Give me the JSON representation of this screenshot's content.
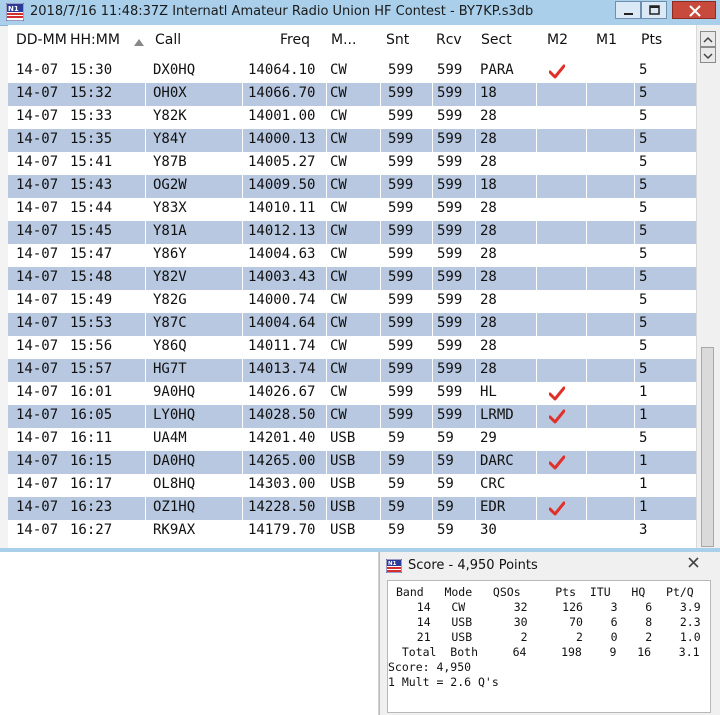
{
  "window": {
    "title": "2018/7/16 11:48:37Z  Internatl Amateur Radio Union HF Contest - BY7KP.s3db",
    "icon": "n1mm-logo-icon"
  },
  "columns": [
    "DD-MM",
    "HH:MM",
    "Call",
    "Freq",
    "M...",
    "Snt",
    "Rcv",
    "Sect",
    "M2",
    "M1",
    "Pts"
  ],
  "rows": [
    {
      "date": "14-07",
      "time": "15:30",
      "call": "DX0HQ",
      "freq": "14064.10",
      "mode": "CW",
      "snt": "599",
      "rcv": "599",
      "sect": "PARA",
      "m2": true,
      "m1": false,
      "pts": "5"
    },
    {
      "date": "14-07",
      "time": "15:32",
      "call": "OH0X",
      "freq": "14066.70",
      "mode": "CW",
      "snt": "599",
      "rcv": "599",
      "sect": "18",
      "m2": false,
      "m1": false,
      "pts": "5"
    },
    {
      "date": "14-07",
      "time": "15:33",
      "call": "Y82K",
      "freq": "14001.00",
      "mode": "CW",
      "snt": "599",
      "rcv": "599",
      "sect": "28",
      "m2": false,
      "m1": false,
      "pts": "5"
    },
    {
      "date": "14-07",
      "time": "15:35",
      "call": "Y84Y",
      "freq": "14000.13",
      "mode": "CW",
      "snt": "599",
      "rcv": "599",
      "sect": "28",
      "m2": false,
      "m1": false,
      "pts": "5"
    },
    {
      "date": "14-07",
      "time": "15:41",
      "call": "Y87B",
      "freq": "14005.27",
      "mode": "CW",
      "snt": "599",
      "rcv": "599",
      "sect": "28",
      "m2": false,
      "m1": false,
      "pts": "5"
    },
    {
      "date": "14-07",
      "time": "15:43",
      "call": "OG2W",
      "freq": "14009.50",
      "mode": "CW",
      "snt": "599",
      "rcv": "599",
      "sect": "18",
      "m2": false,
      "m1": false,
      "pts": "5"
    },
    {
      "date": "14-07",
      "time": "15:44",
      "call": "Y83X",
      "freq": "14010.11",
      "mode": "CW",
      "snt": "599",
      "rcv": "599",
      "sect": "28",
      "m2": false,
      "m1": false,
      "pts": "5"
    },
    {
      "date": "14-07",
      "time": "15:45",
      "call": "Y81A",
      "freq": "14012.13",
      "mode": "CW",
      "snt": "599",
      "rcv": "599",
      "sect": "28",
      "m2": false,
      "m1": false,
      "pts": "5"
    },
    {
      "date": "14-07",
      "time": "15:47",
      "call": "Y86Y",
      "freq": "14004.63",
      "mode": "CW",
      "snt": "599",
      "rcv": "599",
      "sect": "28",
      "m2": false,
      "m1": false,
      "pts": "5"
    },
    {
      "date": "14-07",
      "time": "15:48",
      "call": "Y82V",
      "freq": "14003.43",
      "mode": "CW",
      "snt": "599",
      "rcv": "599",
      "sect": "28",
      "m2": false,
      "m1": false,
      "pts": "5"
    },
    {
      "date": "14-07",
      "time": "15:49",
      "call": "Y82G",
      "freq": "14000.74",
      "mode": "CW",
      "snt": "599",
      "rcv": "599",
      "sect": "28",
      "m2": false,
      "m1": false,
      "pts": "5"
    },
    {
      "date": "14-07",
      "time": "15:53",
      "call": "Y87C",
      "freq": "14004.64",
      "mode": "CW",
      "snt": "599",
      "rcv": "599",
      "sect": "28",
      "m2": false,
      "m1": false,
      "pts": "5"
    },
    {
      "date": "14-07",
      "time": "15:56",
      "call": "Y86Q",
      "freq": "14011.74",
      "mode": "CW",
      "snt": "599",
      "rcv": "599",
      "sect": "28",
      "m2": false,
      "m1": false,
      "pts": "5"
    },
    {
      "date": "14-07",
      "time": "15:57",
      "call": "HG7T",
      "freq": "14013.74",
      "mode": "CW",
      "snt": "599",
      "rcv": "599",
      "sect": "28",
      "m2": false,
      "m1": false,
      "pts": "5"
    },
    {
      "date": "14-07",
      "time": "16:01",
      "call": "9A0HQ",
      "freq": "14026.67",
      "mode": "CW",
      "snt": "599",
      "rcv": "599",
      "sect": "HL",
      "m2": true,
      "m1": false,
      "pts": "1"
    },
    {
      "date": "14-07",
      "time": "16:05",
      "call": "LY0HQ",
      "freq": "14028.50",
      "mode": "CW",
      "snt": "599",
      "rcv": "599",
      "sect": "LRMD",
      "m2": true,
      "m1": false,
      "pts": "1"
    },
    {
      "date": "14-07",
      "time": "16:11",
      "call": "UA4M",
      "freq": "14201.40",
      "mode": "USB",
      "snt": "59",
      "rcv": "59",
      "sect": "29",
      "m2": false,
      "m1": false,
      "pts": "5"
    },
    {
      "date": "14-07",
      "time": "16:15",
      "call": "DA0HQ",
      "freq": "14265.00",
      "mode": "USB",
      "snt": "59",
      "rcv": "59",
      "sect": "DARC",
      "m2": true,
      "m1": false,
      "pts": "1"
    },
    {
      "date": "14-07",
      "time": "16:17",
      "call": "OL8HQ",
      "freq": "14303.00",
      "mode": "USB",
      "snt": "59",
      "rcv": "59",
      "sect": "CRC",
      "m2": false,
      "m1": false,
      "pts": "1"
    },
    {
      "date": "14-07",
      "time": "16:23",
      "call": "OZ1HQ",
      "freq": "14228.50",
      "mode": "USB",
      "snt": "59",
      "rcv": "59",
      "sect": "EDR",
      "m2": true,
      "m1": false,
      "pts": "1"
    },
    {
      "date": "14-07",
      "time": "16:27",
      "call": "RK9AX",
      "freq": "14179.70",
      "mode": "USB",
      "snt": "59",
      "rcv": "59",
      "sect": "30",
      "m2": false,
      "m1": false,
      "pts": "3"
    }
  ],
  "score": {
    "title": "Score - 4,950 Points",
    "lines": [
      "Band   Mode   QSOs     Pts  ITU   HQ   Pt/Q",
      "   14   CW       32     126    3    6    3.9",
      "   14   USB      30      70    6    8    2.3",
      "   21   USB       2       2    0    2    1.0",
      "  Total  Both     64     198    9   16    3.1",
      "Score: 4,950",
      "1 Mult = 2.6 Q's"
    ]
  },
  "colors": {
    "alt_row": "#b8c8e0",
    "check": "#e0302a",
    "titlebar": "#a9cfeb",
    "close": "#c74a3d"
  }
}
